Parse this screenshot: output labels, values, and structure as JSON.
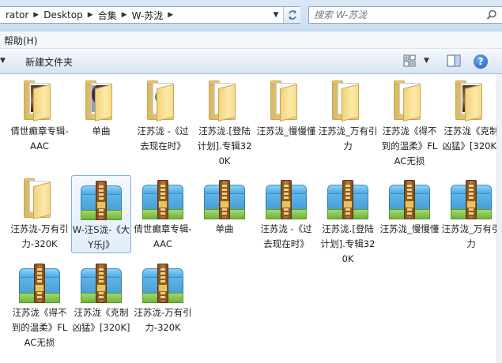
{
  "address": {
    "crumbs": [
      "rator",
      "Desktop",
      "合集",
      "W-苏泷"
    ]
  },
  "search": {
    "placeholder": "搜索 W-苏泷"
  },
  "menu": {
    "help_label": "帮助(H)"
  },
  "toolbar": {
    "new_folder_label": "新建文件夹"
  },
  "items": [
    {
      "label": "倩世癫章专辑-AAC",
      "kind": "folder",
      "preview": "album"
    },
    {
      "label": "单曲",
      "kind": "folder",
      "preview": "photo"
    },
    {
      "label": "汪苏泷 -《过去现在时》",
      "kind": "folder",
      "preview": "ie"
    },
    {
      "label": "汪苏泷.[登陆计划].专辑320K",
      "kind": "folder",
      "preview": "paper"
    },
    {
      "label": "汪苏泷_慢慢懂",
      "kind": "folder",
      "preview": "paper"
    },
    {
      "label": "汪苏泷_万有引力",
      "kind": "folder",
      "preview": "paper"
    },
    {
      "label": "汪苏泷《得不到的温柔》FLAC无损",
      "kind": "folder",
      "preview": "paper"
    },
    {
      "label": "汪苏泷《克制凶猛》[320K]",
      "kind": "folder",
      "preview": "album"
    },
    {
      "label": "汪苏泷-万有引力-320K",
      "kind": "folder",
      "preview": "paper"
    },
    {
      "label": "W-汪S泷-《大Y乐J》",
      "kind": "archive",
      "selected": true
    },
    {
      "label": "倩世癫章专辑-AAC",
      "kind": "archive"
    },
    {
      "label": "单曲",
      "kind": "archive"
    },
    {
      "label": "汪苏泷 -《过去现在时》",
      "kind": "archive"
    },
    {
      "label": "汪苏泷.[登陆计划].专辑320K",
      "kind": "archive"
    },
    {
      "label": "汪苏泷_慢慢懂",
      "kind": "archive"
    },
    {
      "label": "汪苏泷_万有引力",
      "kind": "archive"
    },
    {
      "label": "汪苏泷《得不到的温柔》FLAC无损",
      "kind": "archive"
    },
    {
      "label": "汪苏泷《克制凶猛》[320K]",
      "kind": "archive"
    },
    {
      "label": "汪苏泷-万有引力-320K",
      "kind": "archive"
    }
  ]
}
